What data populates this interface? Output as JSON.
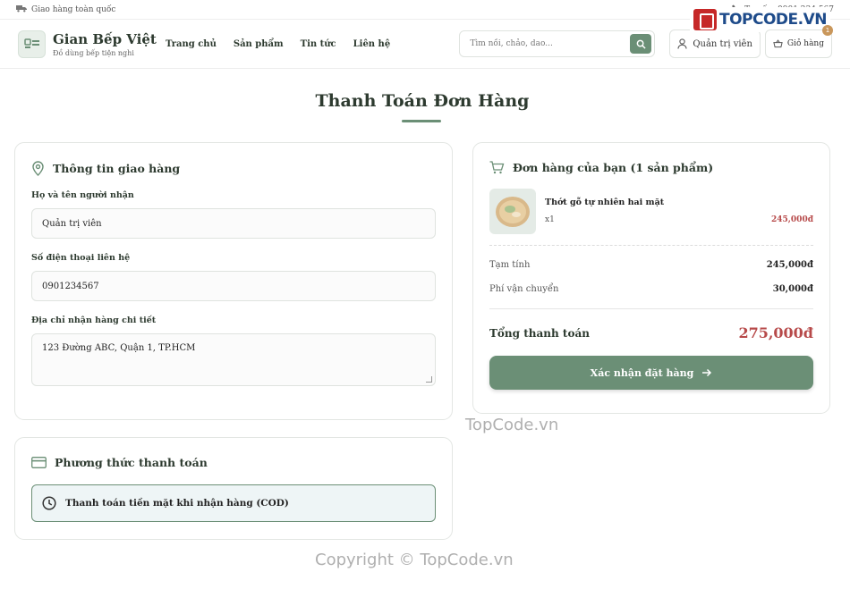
{
  "topbar": {
    "shipping_note": "Giao hàng toàn quốc",
    "hotline": "Tư vấn: 0901 234 567"
  },
  "watermark_logo": "TOPCODE.VN",
  "header": {
    "brand_name": "Gian Bếp Việt",
    "brand_tagline": "Đồ dùng bếp tiện nghi",
    "nav": [
      "Trang chủ",
      "Sản phẩm",
      "Tin tức",
      "Liên hệ"
    ],
    "search_placeholder": "Tìm nồi, chảo, dao...",
    "account_label": "Quản trị viên",
    "cart_label": "Giỏ hàng",
    "cart_count": "1"
  },
  "page_title": "Thanh Toán Đơn Hàng",
  "shipping": {
    "title": "Thông tin giao hàng",
    "name_label": "Họ và tên người nhận",
    "name_value": "Quản trị viên",
    "phone_label": "Số điện thoại liên hệ",
    "phone_value": "0901234567",
    "address_label": "Địa chỉ nhận hàng chi tiết",
    "address_value": "123 Đường ABC, Quận 1, TP.HCM"
  },
  "payment": {
    "title": "Phương thức thanh toán",
    "method": "Thanh toán tiền mặt khi nhận hàng (COD)"
  },
  "order": {
    "title": "Đơn hàng của bạn (1 sản phẩm)",
    "item": {
      "name": "Thớt gỗ tự nhiên hai mặt",
      "qty": "x1",
      "price": "245,000đ"
    },
    "subtotal_label": "Tạm tính",
    "subtotal_value": "245,000đ",
    "shipping_label": "Phí vận chuyển",
    "shipping_value": "30,000đ",
    "total_label": "Tổng thanh toán",
    "total_value": "275,000đ",
    "confirm_label": "Xác nhận đặt hàng"
  },
  "watermarks": {
    "center": "TopCode.vn",
    "footer": "Copyright © TopCode.vn"
  },
  "colors": {
    "accent": "#6b8f76",
    "price": "#b74a4a"
  }
}
